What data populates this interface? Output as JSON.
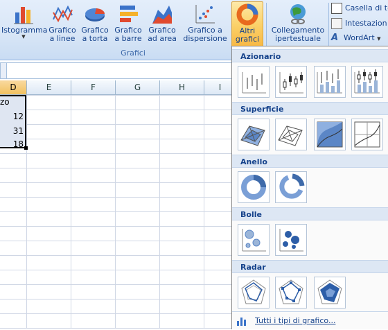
{
  "ribbon": {
    "buttons": [
      {
        "label": "Istogramma",
        "icon": "column-chart-icon"
      },
      {
        "label": "Grafico\na linee",
        "icon": "line-chart-icon"
      },
      {
        "label": "Grafico\na torta",
        "icon": "pie-chart-icon"
      },
      {
        "label": "Grafico\na barre",
        "icon": "bar-chart-icon"
      },
      {
        "label": "Grafico\nad area",
        "icon": "area-chart-icon"
      },
      {
        "label": "Grafico a\ndispersione",
        "icon": "scatter-chart-icon"
      },
      {
        "label": "Altri\ngrafici",
        "icon": "other-charts-icon"
      }
    ],
    "link_button": {
      "label": "Collegamento\nipertestuale",
      "icon": "hyperlink-icon"
    },
    "group_label": "Grafici",
    "small_buttons": [
      "Casella di te",
      "Intestazion",
      "WordArt"
    ]
  },
  "sheet": {
    "columns": [
      "D",
      "E",
      "F",
      "G",
      "H",
      "I"
    ],
    "header_cell": "zo",
    "values": [
      "12",
      "31",
      "18"
    ]
  },
  "dropdown": {
    "sections": [
      "Azionario",
      "Superficie",
      "Anello",
      "Bolle",
      "Radar"
    ],
    "footer_link": "Tutti i tipi di grafico..."
  },
  "colors": {
    "accent": "#15428b",
    "highlight": "#f8b844",
    "section_bg": "#dde7f4"
  }
}
